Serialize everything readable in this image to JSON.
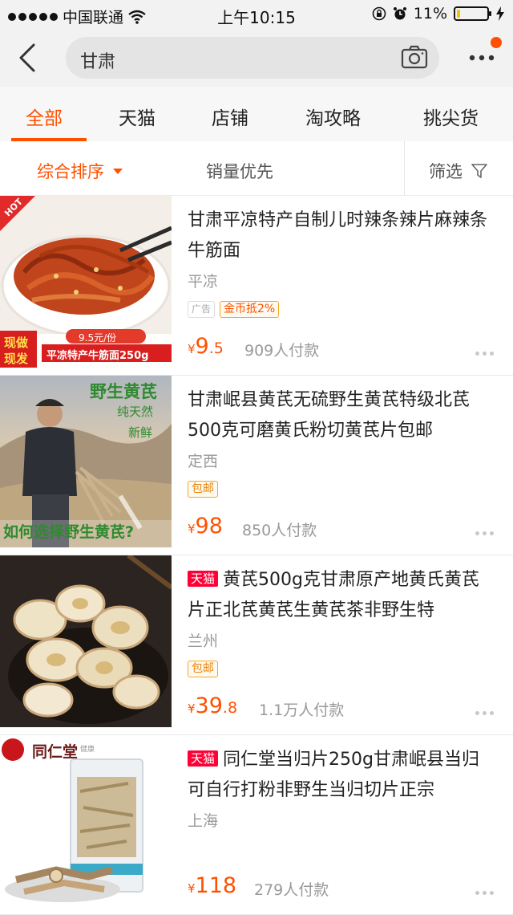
{
  "status_bar": {
    "carrier": "中国联通",
    "time": "上午10:15",
    "battery": "11%",
    "battery_level": 0.11
  },
  "search": {
    "query": "甘肃"
  },
  "tabs": [
    {
      "label": "全部",
      "active": true
    },
    {
      "label": "天猫",
      "active": false
    },
    {
      "label": "店铺",
      "active": false
    },
    {
      "label": "淘攻略",
      "active": false
    },
    {
      "label": "挑尖货",
      "active": false
    }
  ],
  "sort": {
    "comprehensive": "综合排序",
    "sales_first": "销量优先",
    "filter": "筛选"
  },
  "colors": {
    "accent": "#ff5000",
    "tmall": "#ff0036",
    "price": "#ff5000"
  },
  "items": [
    {
      "title": "甘肃平凉特产自制儿时辣条辣片麻辣条牛筋面",
      "location": "平凉",
      "tags": [
        "广告",
        "金币抵2%"
      ],
      "price_currency": "¥",
      "price_int": "9",
      "price_dec": ".5",
      "sales": "909人付款",
      "thumb": {
        "hot": "HOT",
        "badge1": "现做",
        "badge2": "现发",
        "price_tag": "9.5元/份",
        "desc": "平凉特产牛筋面250g"
      }
    },
    {
      "title": "甘肃岷县黄芪无硫野生黄芪特级北芪500克可磨黄氏粉切黄芪片包邮",
      "location": "定西",
      "tags": [
        "包邮"
      ],
      "price_currency": "¥",
      "price_int": "98",
      "price_dec": "",
      "sales": "850人付款",
      "thumb": {
        "line1": "野生黄芪",
        "line2": "纯天然",
        "line3": "新鲜",
        "caption": "如何选择野生黄芪?"
      }
    },
    {
      "tmall_badge": "天猫",
      "title": "黄芪500g克甘肃原产地黄氏黄芪片正北芪黄芪生黄芪茶非野生特",
      "location": "兰州",
      "tags": [
        "包邮"
      ],
      "price_currency": "¥",
      "price_int": "39",
      "price_dec": ".8",
      "sales": "1.1万人付款"
    },
    {
      "tmall_badge": "天猫",
      "title": "同仁堂当归片250g甘肃岷县当归可自行打粉非野生当归切片正宗",
      "location": "上海",
      "tags": [],
      "price_currency": "¥",
      "price_int": "118",
      "price_dec": "",
      "sales": "279人付款",
      "thumb": {
        "brand": "同仁堂",
        "brand_sub": "健康"
      }
    }
  ]
}
